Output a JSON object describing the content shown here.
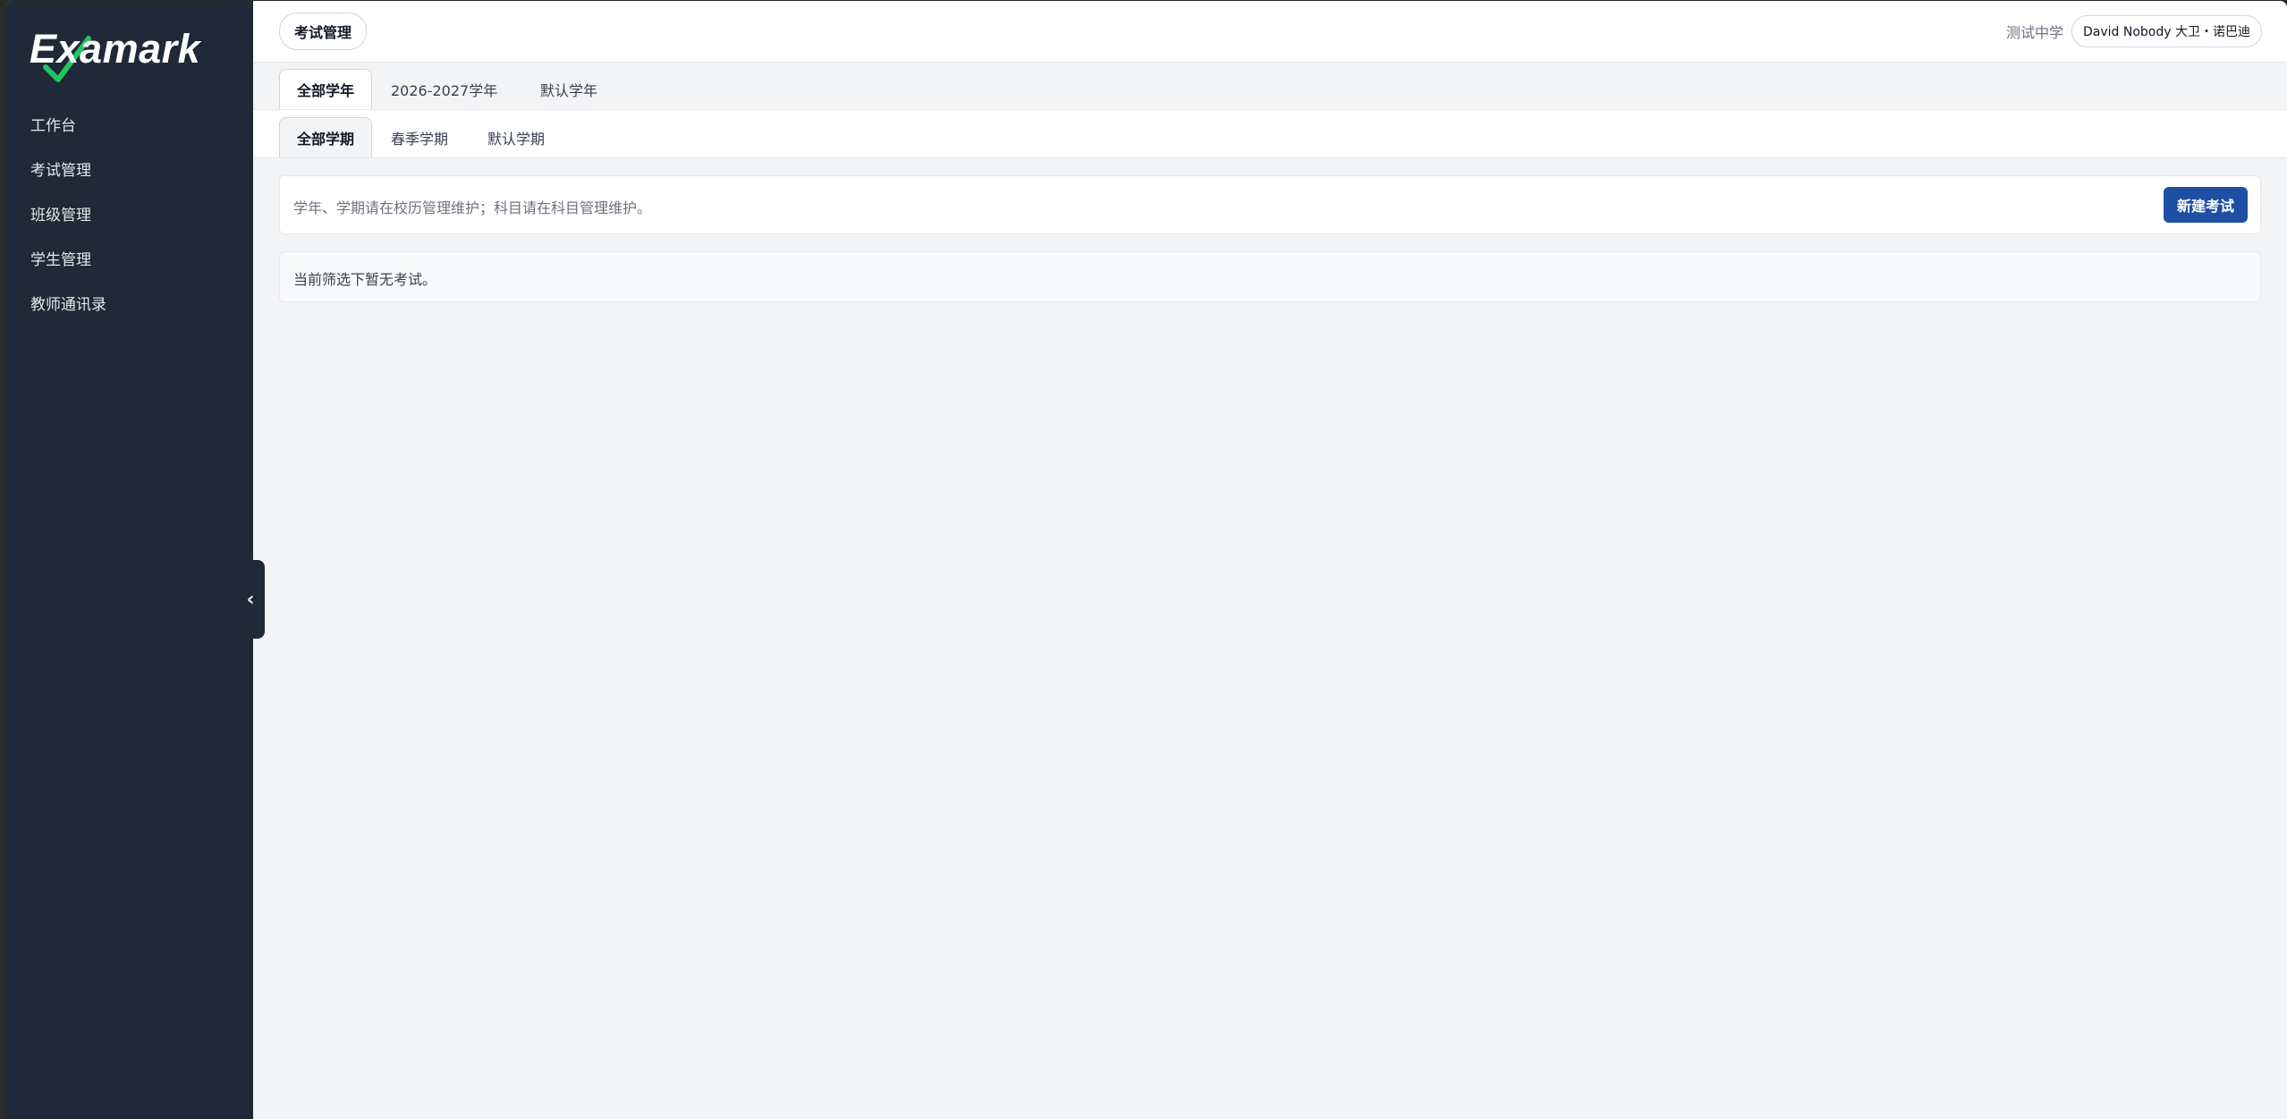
{
  "app": {
    "logo_text": "Examark"
  },
  "sidebar": {
    "items": [
      {
        "label": "工作台"
      },
      {
        "label": "考试管理"
      },
      {
        "label": "班级管理"
      },
      {
        "label": "学生管理"
      },
      {
        "label": "教师通讯录"
      }
    ],
    "collapse_icon": "chevron-left-icon"
  },
  "header": {
    "page_title": "考试管理",
    "school_name": "测试中学",
    "user_label": "David Nobody 大卫・诺巴迪"
  },
  "year_tabs": [
    {
      "label": "全部学年",
      "active": true
    },
    {
      "label": "2026-2027学年",
      "active": false
    },
    {
      "label": "默认学年",
      "active": false
    }
  ],
  "term_tabs": [
    {
      "label": "全部学期",
      "active": true
    },
    {
      "label": "春季学期",
      "active": false
    },
    {
      "label": "默认学期",
      "active": false
    }
  ],
  "info": {
    "text": "学年、学期请在校历管理维护；科目请在科目管理维护。",
    "new_button_label": "新建考试"
  },
  "empty_state": {
    "text": "当前筛选下暂无考试。"
  },
  "colors": {
    "sidebar_bg": "#1f2937",
    "primary_button": "#1e4fa3",
    "logo_check": "#22c55e"
  }
}
